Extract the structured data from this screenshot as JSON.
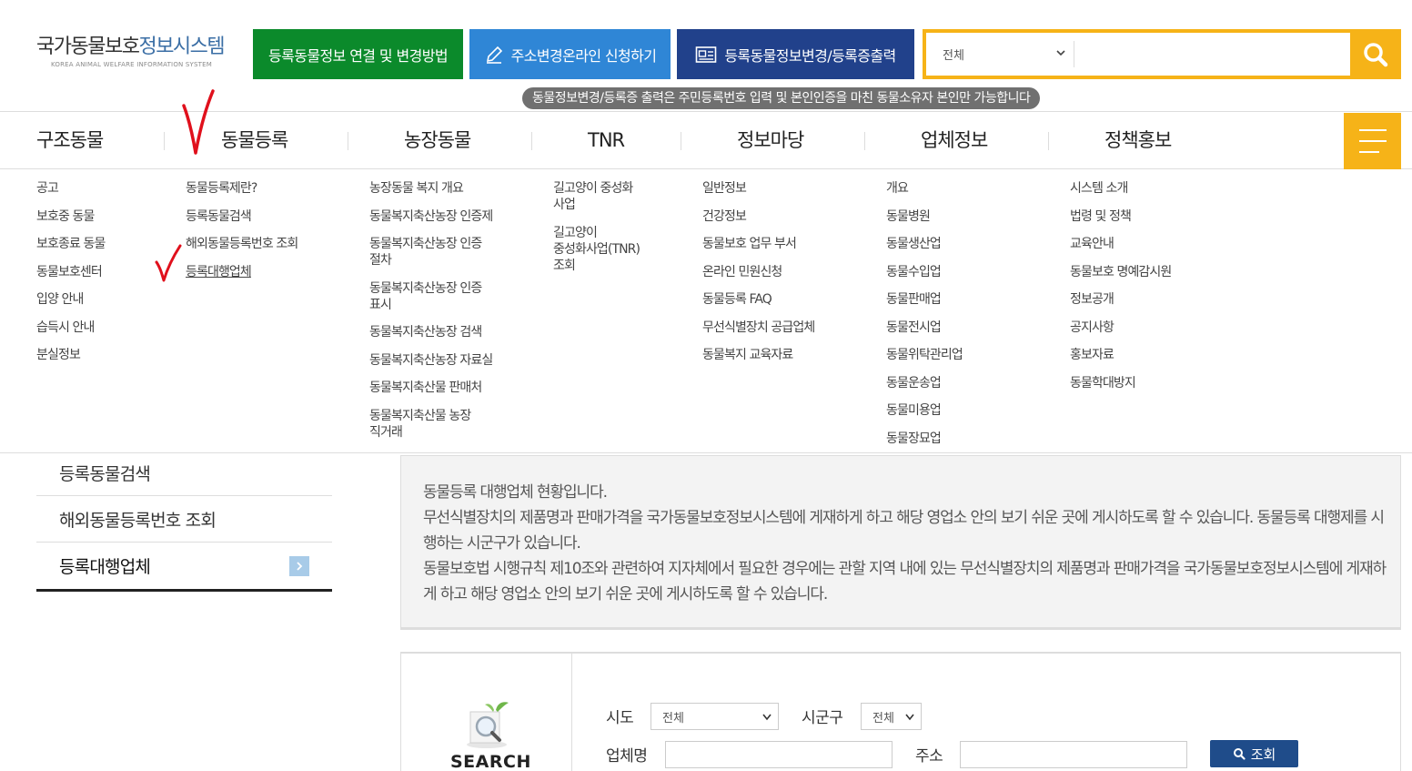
{
  "header": {
    "logo_title_part1": "국가동물보호",
    "logo_title_part2": "정보시스템",
    "logo_subtitle": "KOREA ANIMAL WELFARE INFORMATION SYSTEM",
    "btn_link_change": "등록동물정보 연결 및 변경방법",
    "btn_address_change": "주소변경온라인 신청하기",
    "btn_info_change_print": "등록동물정보변경/등록증출력",
    "search_select_value": "전체",
    "search_placeholder": "",
    "notice": "동물정보변경/등록증 출력은 주민등록번호 입력 및 본인인증을 마친 동물소유자 본인만 가능합니다"
  },
  "gnb": {
    "items": [
      "구조동물",
      "동물등록",
      "농장동물",
      "TNR",
      "정보마당",
      "업체정보",
      "정책홍보"
    ]
  },
  "mega_menu": {
    "rescue": [
      "공고",
      "보호중 동물",
      "보호종료 동물",
      "동물보호센터",
      "입양 안내",
      "습득시 안내",
      "분실정보"
    ],
    "registration": [
      "동물등록제란?",
      "등록동물검색",
      "해외동물등록번호 조회",
      "등록대행업체"
    ],
    "farm": [
      "농장동물 복지 개요",
      "동물복지축산농장 인증제",
      "동물복지축산농장 인증\n절차",
      "동물복지축산농장 인증\n표시",
      "동물복지축산농장 검색",
      "동물복지축산농장 자료실",
      "동물복지축산물 판매처",
      "동물복지축산물 농장\n직거래"
    ],
    "tnr": [
      "길고양이 중성화\n사업",
      "길고양이\n중성화사업(TNR)\n조회"
    ],
    "info": [
      "일반정보",
      "건강정보",
      "동물보호 업무 부서",
      "온라인 민원신청",
      "동물등록 FAQ",
      "무선식별장치 공급업체",
      "동물복지 교육자료"
    ],
    "business": [
      "개요",
      "동물병원",
      "동물생산업",
      "동물수입업",
      "동물판매업",
      "동물전시업",
      "동물위탁관리업",
      "동물운송업",
      "동물미용업",
      "동물장묘업"
    ],
    "policy": [
      "시스템 소개",
      "법령 및 정책",
      "교육안내",
      "동물보호 명예감시원",
      "정보공개",
      "공지사항",
      "홍보자료",
      "동물학대방지"
    ]
  },
  "lnb": {
    "items": [
      "등록동물검색",
      "해외동물등록번호 조회",
      "등록대행업체"
    ]
  },
  "intro": {
    "line1": "동물등록 대행업체 현황입니다.",
    "line2": "무선식별장치의 제품명과 판매가격을 국가동물보호정보시스템에 게재하게 하고 해당 영업소 안의 보기 쉬운 곳에 게시하도록 할 수 있습니다. 동물등록 대행제를 시행하는 시군구가 있습니다.",
    "line3": "동물보호법 시행규칙 제10조와 관련하여 지자체에서 필요한 경우에는 관할 지역 내에 있는 무선식별장치의 제품명과 판매가격을 국가동물보호정보시스템에 게재하게 하고 해당 영업소 안의 보기 쉬운 곳에 게시하도록 할 수 있습니다."
  },
  "search_panel": {
    "title": "SEARCH",
    "sido_label": "시도",
    "sido_value": "전체",
    "sigungu_label": "시군구",
    "sigungu_value": "전체",
    "company_label": "업체명",
    "address_label": "주소",
    "search_button": "조회"
  },
  "colors": {
    "green": "#0b8a2b",
    "blue": "#2f86d6",
    "navy": "#21418b",
    "yellow": "#f6b318",
    "annotation_red": "#e0101c"
  }
}
